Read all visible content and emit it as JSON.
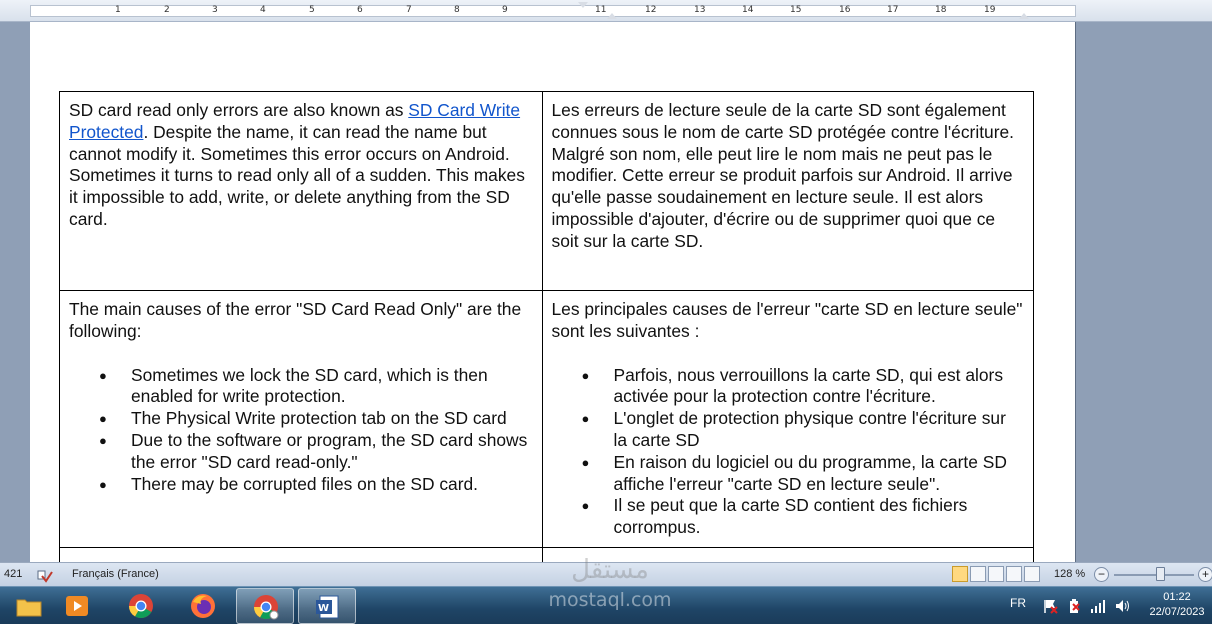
{
  "ruler": {
    "numbers": [
      "1",
      "2",
      "3",
      "4",
      "5",
      "6",
      "7",
      "8",
      "9",
      "11",
      "12",
      "13",
      "14",
      "15",
      "16",
      "17",
      "18",
      "19"
    ]
  },
  "document": {
    "rows": [
      {
        "left": {
          "text_before_link": "SD card read only errors are also known as ",
          "link_text": "SD Card Write Protected",
          "text_after_link": ". Despite the name, it can read the name but cannot modify it. Sometimes this error occurs on Android. Sometimes it turns to read only all of a sudden. This makes it impossible to add, write, or delete anything from the SD card."
        },
        "right": {
          "text": "Les erreurs de lecture seule de la carte SD sont également connues sous le nom de carte SD protégée contre l'écriture. Malgré son nom, elle peut lire le nom mais ne peut pas le modifier. Cette erreur se produit parfois sur Android. Il arrive qu'elle passe soudainement en lecture seule. Il est alors impossible d'ajouter, d'écrire ou de supprimer quoi que ce soit sur la carte SD."
        }
      },
      {
        "left": {
          "intro": "The main causes of the error \"SD Card Read Only\" are the following:",
          "bullets": [
            "Sometimes we lock the SD card, which is then enabled for write protection.",
            "The Physical Write protection tab on the SD card",
            "Due to the software or program, the SD card shows the error \"SD card read-only.\"",
            "There may be corrupted files on the SD card."
          ]
        },
        "right": {
          "intro": "Les principales causes de l'erreur \"carte SD en lecture seule\" sont les suivantes :",
          "bullets": [
            "Parfois, nous verrouillons la carte SD, qui est alors activée pour la protection contre l'écriture.",
            "L'onglet de protection physique contre l'écriture sur la carte SD",
            "En raison du logiciel ou du programme, la carte SD affiche l'erreur \"carte SD en lecture seule\".",
            "Il se peut que la carte SD contient des fichiers corrompus."
          ]
        }
      }
    ]
  },
  "statusbar": {
    "word_count": "421",
    "language": "Français (France)",
    "zoom": "128 %",
    "zoom_out_label": "−",
    "zoom_in_label": "+"
  },
  "taskbar": {
    "apps": [
      {
        "name": "file-explorer",
        "color": "#f3c24a"
      },
      {
        "name": "media-player",
        "color": "#f08a24"
      },
      {
        "name": "chrome",
        "color": "#db4437"
      },
      {
        "name": "firefox",
        "color": "#ff7139"
      },
      {
        "name": "chrome-profile",
        "color": "#db4437"
      },
      {
        "name": "word",
        "color": "#2b579a"
      }
    ],
    "tray_language": "FR",
    "time": "01:22",
    "date": "22/07/2023"
  },
  "watermark": {
    "arabic": "مستقل",
    "text": "mostaql.com"
  }
}
